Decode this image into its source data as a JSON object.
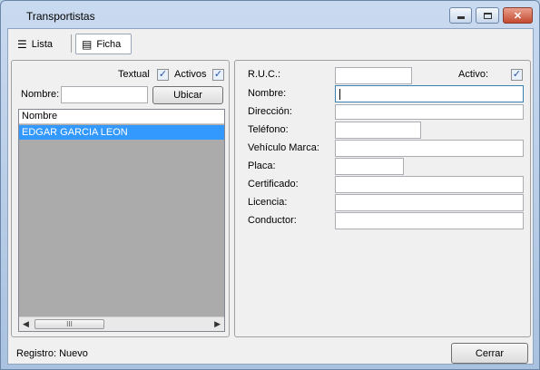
{
  "window": {
    "title": "Transportistas",
    "buttons": {
      "minimize": "minimize-icon",
      "maximize": "maximize-icon",
      "close": "close-icon"
    }
  },
  "tabs": [
    {
      "label": "Lista",
      "icon": "list-icon",
      "active": false
    },
    {
      "label": "Ficha",
      "icon": "form-icon",
      "active": true
    }
  ],
  "left": {
    "textual_label": "Textual",
    "textual_checked": true,
    "activos_label": "Activos",
    "activos_checked": true,
    "nombre_label": "Nombre:",
    "nombre_value": "",
    "ubicar_label": "Ubicar",
    "grid": {
      "column": "Nombre",
      "rows": [
        "EDGAR  GARCIA LEON"
      ],
      "selected_index": 0,
      "thumb_glyph": "III"
    }
  },
  "form": {
    "ruc_label": "R.U.C.:",
    "activo_label": "Activo:",
    "activo_checked": true,
    "fields": [
      {
        "label": "Nombre:",
        "value": ""
      },
      {
        "label": "Dirección:",
        "value": ""
      },
      {
        "label": "Teléfono:",
        "value": ""
      },
      {
        "label": "Vehículo Marca:",
        "value": ""
      },
      {
        "label": "Placa:",
        "value": ""
      },
      {
        "label": "Certificado:",
        "value": ""
      },
      {
        "label": "Licencia:",
        "value": ""
      },
      {
        "label": "Conductor:",
        "value": ""
      }
    ]
  },
  "status": {
    "text": "Registro: Nuevo"
  },
  "cerrar_label": "Cerrar",
  "colors": {
    "selection": "#3399ff",
    "grid_bg": "#ababab",
    "close_button": "#c44a2f"
  }
}
